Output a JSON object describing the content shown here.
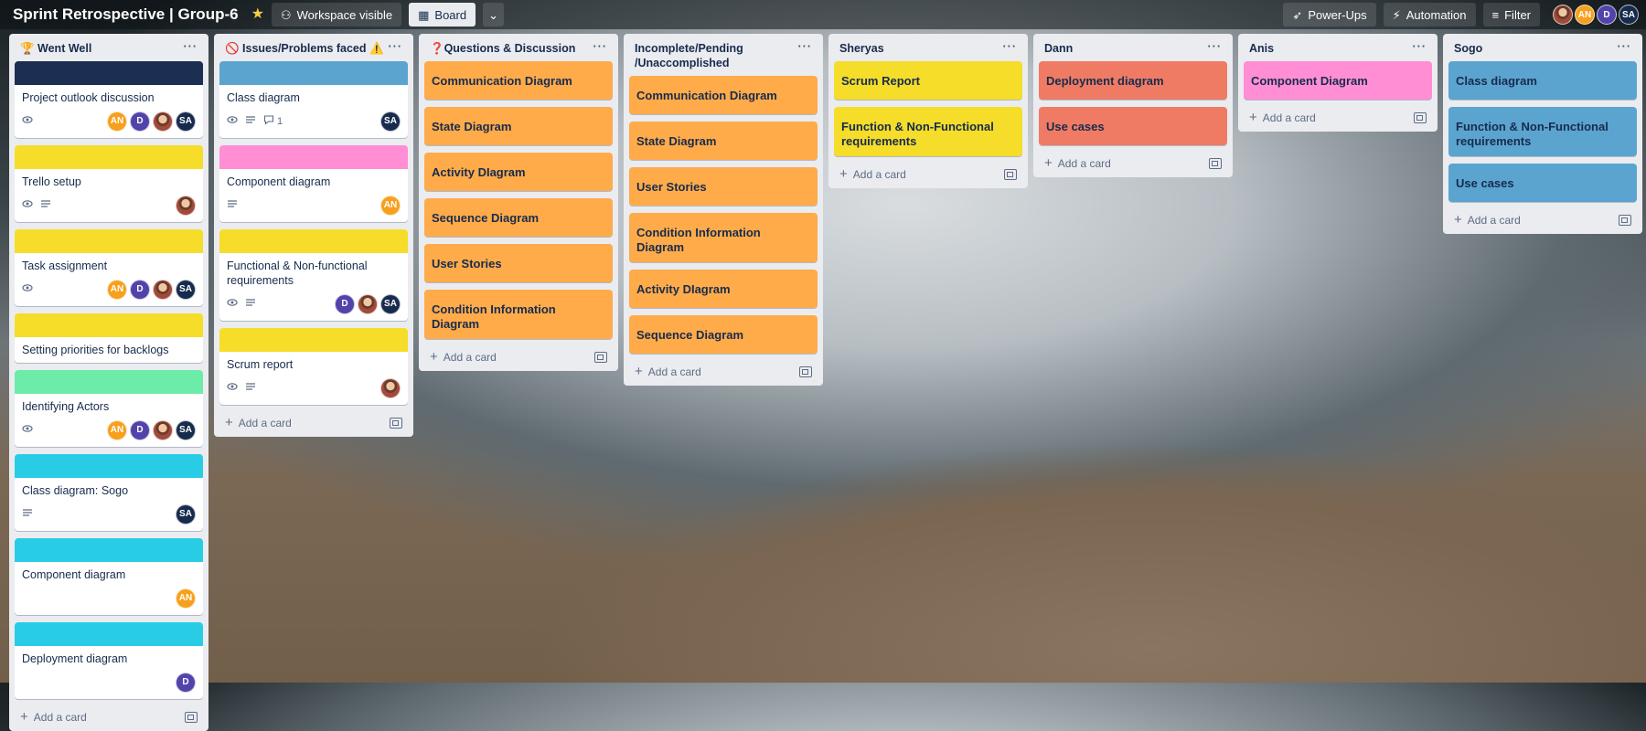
{
  "board": {
    "title": "Sprint Retrospective | Group-6",
    "visibility_label": "Workspace visible",
    "view_label": "Board",
    "powerups_label": "Power-Ups",
    "automation_label": "Automation",
    "filter_label": "Filter",
    "members": [
      "AN",
      "D",
      "SA"
    ]
  },
  "colors": {
    "navy": "#1c2f52",
    "yellow": "#f5dd29",
    "pink": "#ff8ed4",
    "mint": "#6deca9",
    "sky": "#29cce5",
    "blue": "#5ba4cf",
    "orange": "#ffab4a",
    "red": "#f07b64",
    "av_AN": "#f6a01d",
    "av_D": "#5243aa",
    "av_SA": "#172b4d"
  },
  "add_card_label": "Add a card",
  "lists": [
    {
      "title": "🏆 Went Well",
      "cards": [
        {
          "cover": "navy",
          "title": "Project outlook discussion",
          "watch": true,
          "desc": false,
          "members": [
            "AN",
            "D",
            "photo",
            "SA"
          ]
        },
        {
          "cover": "yellow",
          "title": "Trello setup",
          "watch": true,
          "desc": true,
          "members": [
            "photo"
          ]
        },
        {
          "cover": "yellow",
          "title": "Task assignment",
          "watch": true,
          "desc": false,
          "members": [
            "AN",
            "D",
            "photo",
            "SA"
          ]
        },
        {
          "cover": "yellow",
          "title": "Setting priorities for backlogs",
          "watch": false,
          "desc": false,
          "members": []
        },
        {
          "cover": "mint",
          "title": "Identifying Actors",
          "watch": true,
          "desc": false,
          "members": [
            "AN",
            "D",
            "photo",
            "SA"
          ]
        },
        {
          "cover": "sky",
          "title": "Class diagram: Sogo",
          "watch": false,
          "desc": true,
          "members": [
            "SA"
          ]
        },
        {
          "cover": "sky",
          "title": "Component diagram",
          "watch": false,
          "desc": false,
          "members": [
            "AN"
          ]
        },
        {
          "cover": "sky",
          "title": "Deployment diagram",
          "watch": false,
          "desc": false,
          "members": [
            "D"
          ]
        }
      ]
    },
    {
      "title": "🚫 Issues/Problems faced ⚠️",
      "cards": [
        {
          "cover": "blue",
          "title": "Class diagram",
          "watch": true,
          "desc": true,
          "comments": "1",
          "members": [
            "SA"
          ]
        },
        {
          "cover": "pink",
          "title": "Component diagram",
          "watch": false,
          "desc": true,
          "members": [
            "AN"
          ]
        },
        {
          "cover": "yellow",
          "title": "Functional & Non-functional requirements",
          "watch": true,
          "desc": true,
          "members": [
            "D",
            "photo",
            "SA"
          ]
        },
        {
          "cover": "yellow",
          "title": "Scrum report",
          "watch": true,
          "desc": true,
          "members": [
            "photo"
          ]
        }
      ]
    },
    {
      "title": "❓Questions & Discussion",
      "full": "orange",
      "cards": [
        {
          "title": "Communication Diagram"
        },
        {
          "title": "State Diagram"
        },
        {
          "title": "Activity DIagram"
        },
        {
          "title": "Sequence Diagram"
        },
        {
          "title": "User Stories"
        },
        {
          "title": "Condition Information Diagram"
        }
      ]
    },
    {
      "title": "Incomplete/Pending /Unaccomplished",
      "full": "orange",
      "cards": [
        {
          "title": "Communication Diagram"
        },
        {
          "title": "State Diagram"
        },
        {
          "title": "User Stories"
        },
        {
          "title": "Condition Information Diagram"
        },
        {
          "title": "Activity DIagram"
        },
        {
          "title": "Sequence Diagram"
        }
      ]
    },
    {
      "title": "Sheryas",
      "full": "yellow",
      "cards": [
        {
          "title": "Scrum Report"
        },
        {
          "title": "Function & Non-Functional requirements"
        }
      ]
    },
    {
      "title": "Dann",
      "full": "red",
      "cards": [
        {
          "title": "Deployment diagram"
        },
        {
          "title": "Use cases"
        }
      ]
    },
    {
      "title": "Anis",
      "full": "pink",
      "cards": [
        {
          "title": "Component Diagram"
        }
      ]
    },
    {
      "title": "Sogo",
      "full": "blue",
      "cards": [
        {
          "title": "Class diagram"
        },
        {
          "title": "Function & Non-Functional requirements"
        },
        {
          "title": "Use cases"
        }
      ]
    }
  ]
}
